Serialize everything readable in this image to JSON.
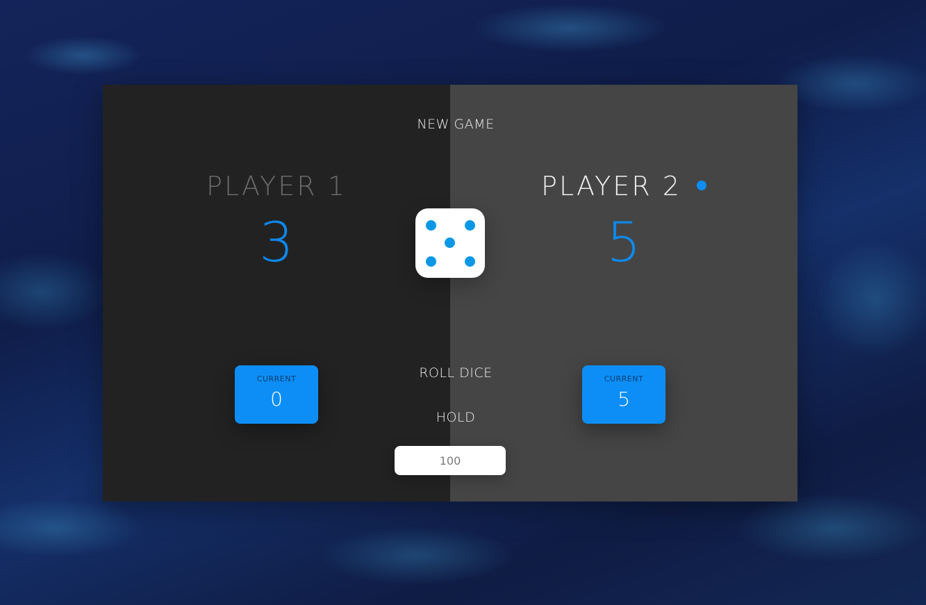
{
  "controls": {
    "new_game_label": "NEW GAME",
    "roll_dice_label": "ROLL DICE",
    "hold_label": "HOLD",
    "target_score_value": "100"
  },
  "players": [
    {
      "name": "PLAYER 1",
      "score": "3",
      "current_label": "CURRENT",
      "current_score": "0",
      "active": false
    },
    {
      "name": "PLAYER 2",
      "score": "5",
      "current_label": "CURRENT",
      "current_score": "5",
      "active": true
    }
  ],
  "dice": {
    "value": 5,
    "icon": "dice-five-icon"
  },
  "colors": {
    "accent": "#0d8ef7",
    "panel_inactive": "#222222",
    "panel_active": "#454545",
    "pip": "#0a98e6"
  }
}
